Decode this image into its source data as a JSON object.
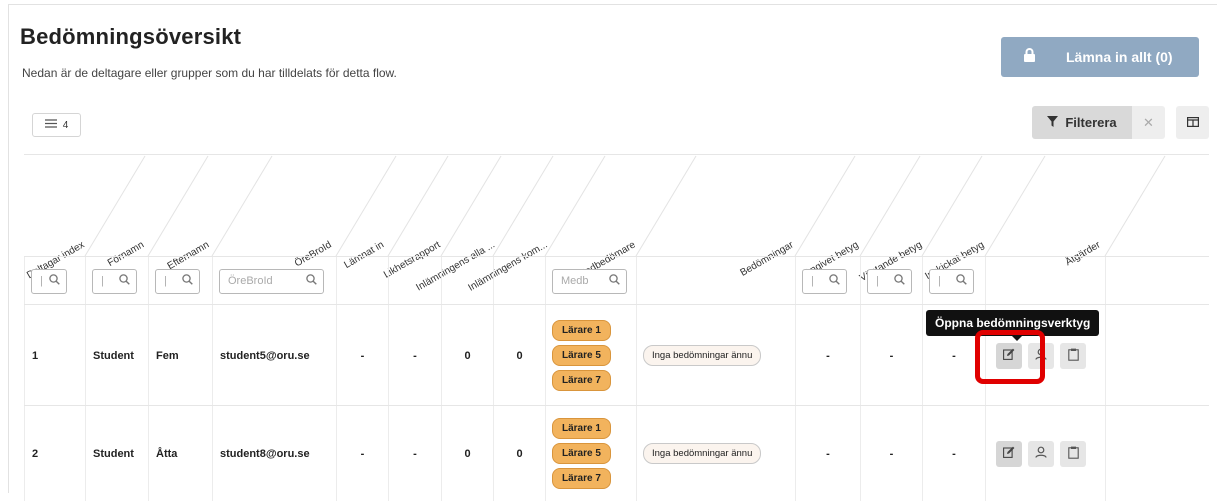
{
  "page": {
    "title": "Bedömningsöversikt",
    "subtitle": "Nedan är de deltagare eller grupper som du har tilldelats för detta flow."
  },
  "toolbar": {
    "submit_all_label": "Lämna in allt (0)",
    "rows_count": "4",
    "filter_label": "Filterera"
  },
  "columns": [
    "Deltagar index",
    "Förnamn",
    "Efternamn",
    "ÖreBroId",
    "Lämnat in",
    "Likhetsrapport",
    "Inlämningens alla ...",
    "Inlämningens kom...",
    "Medbedömare",
    "Bedömningar",
    "Angivet betyg",
    "Väntande betyg",
    "Inskickat betyg",
    "Åtgärder"
  ],
  "filters": {
    "email_placeholder": "ÖreBroId",
    "cobedomare_placeholder": "Medb"
  },
  "rows": [
    {
      "index": "1",
      "first": "Student",
      "last": "Fem",
      "email": "student5@oru.se",
      "submitted": "-",
      "similarity": "-",
      "all_sub": "0",
      "comments": "0",
      "teachers": [
        "Lärare 1",
        "Lärare 5",
        "Lärare 7"
      ],
      "assessments": "Inga bedömningar ännu",
      "given": "-",
      "pending": "-",
      "sent": "-"
    },
    {
      "index": "2",
      "first": "Student",
      "last": "Åtta",
      "email": "student8@oru.se",
      "submitted": "-",
      "similarity": "-",
      "all_sub": "0",
      "comments": "0",
      "teachers": [
        "Lärare 1",
        "Lärare 5",
        "Lärare 7"
      ],
      "assessments": "Inga bedömningar ännu",
      "given": "-",
      "pending": "-",
      "sent": "-"
    }
  ],
  "tooltip": "Öppna bedömningsverktyg",
  "colors": {
    "accent": "#90a9c2",
    "pill": "#f2b35d",
    "highlight": "#e00000"
  },
  "icons": [
    "lock-icon",
    "list-icon",
    "filter-icon",
    "close-icon",
    "columns-icon",
    "search-icon",
    "edit-icon",
    "user-icon",
    "clipboard-icon"
  ]
}
